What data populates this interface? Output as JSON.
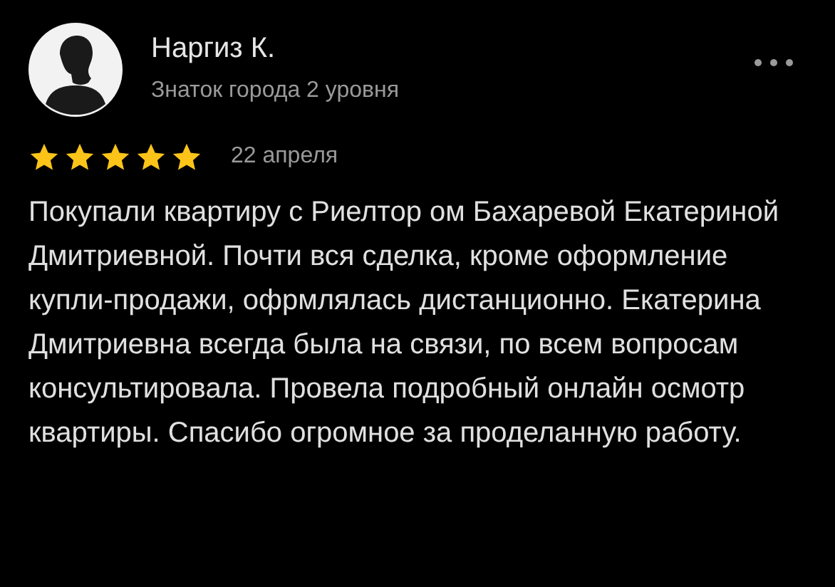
{
  "review": {
    "author": "Наргиз К.",
    "author_level": "Знаток города 2 уровня",
    "stars": 5,
    "date": "22 апреля",
    "text": "Покупали квартиру с Риелтор ом Бахаревой Екатериной Дмитриевной. Почти вся сделка, кроме оформление купли-продажи, офрмлялась дистанционно. Екатерина Дмитриевна всегда была на связи, по всем вопросам консультировала. Провела подробный онлайн осмотр квартиры. Спасибо огромное за проделанную работу."
  }
}
